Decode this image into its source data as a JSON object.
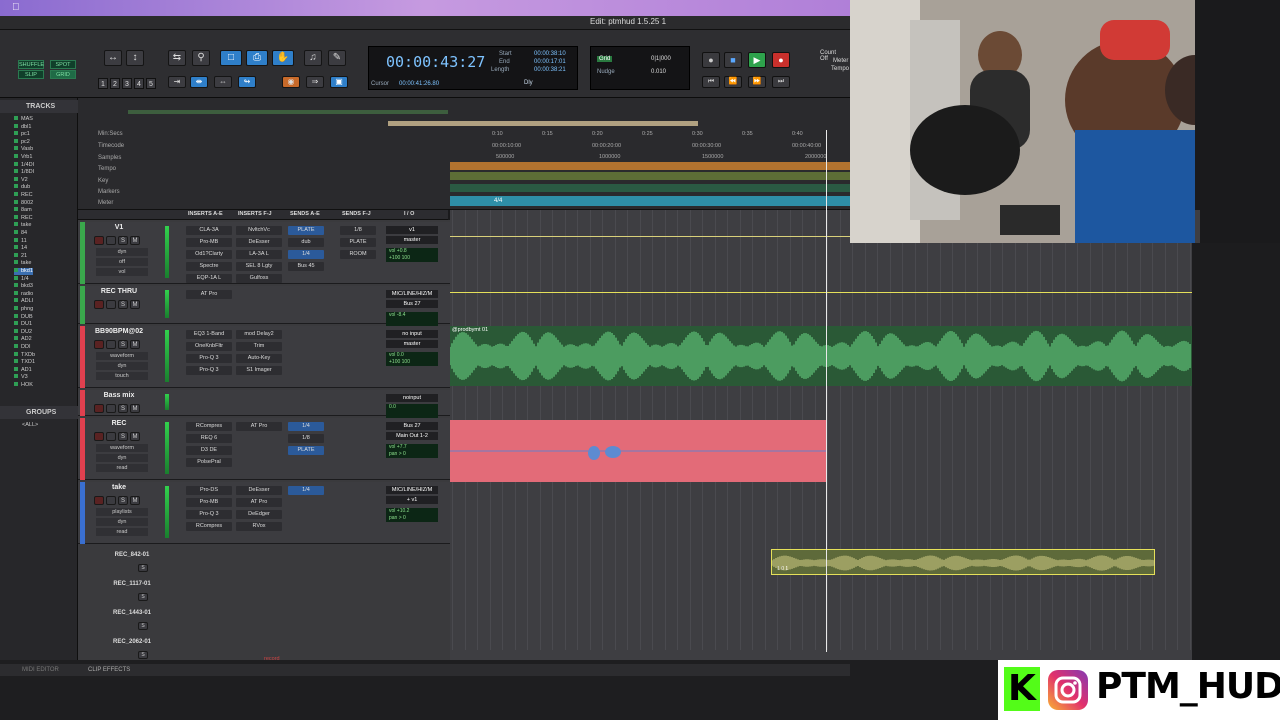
{
  "menubar": {
    "apple": ""
  },
  "window": {
    "title": "Edit: ptmhud 1.5.25 1"
  },
  "toolbar": {
    "modes": [
      "SHUFFLE",
      "SPOT",
      "SLIP",
      "GRID"
    ],
    "numbers": [
      "1",
      "2",
      "3",
      "4",
      "5"
    ],
    "counter": {
      "main": "00:00:43:27",
      "start_label": "Start",
      "end_label": "End",
      "length_label": "Length",
      "start": "00:00:38:10",
      "end": "00:00:17:01",
      "length": "00:00:38:21",
      "cursor_label": "Cursor",
      "cursor": "00:00:41:26.80",
      "dly": "Dly"
    },
    "edit": {
      "grid_label": "Grid",
      "grid_value": "0|1|000",
      "nudge_label": "Nudge",
      "nudge_value": "0.010"
    },
    "countoff": "Count Off",
    "meter": "Meter",
    "tempo": "Tempo"
  },
  "sidebar": {
    "tracks_header": "TRACKS",
    "groups_header": "GROUPS",
    "groups_item": "<ALL>",
    "tracks": [
      "MAS",
      "dbl1",
      "pc1",
      "pc2",
      "Vasb",
      "Vrb1",
      "1/4DI",
      "1/8DI",
      "V2",
      "dub",
      "REC",
      "8002",
      "8am",
      "REC",
      "take",
      "84",
      "11",
      "14",
      "21",
      "take",
      "bkd1",
      "1/4",
      "bkd3",
      "radio",
      "ADLI",
      "phng",
      "DUB",
      "DU1",
      "DU2",
      "AD2",
      "DDI",
      "TXDb",
      "TXD1",
      "AD1",
      "V3",
      "HOK"
    ]
  },
  "rulers": {
    "labels": [
      "Min:Secs",
      "Timecode",
      "Samples",
      "Tempo",
      "Key",
      "Markers",
      "Meter"
    ],
    "ticks_min": [
      "0:10",
      "0:15",
      "0:20",
      "0:25",
      "0:30",
      "0:35",
      "0:40"
    ],
    "ticks_tc": [
      "00:00:10:00",
      "00:00:20:00",
      "00:00:30:00",
      "00:00:40:00"
    ],
    "ticks_samp": [
      "500000",
      "1000000",
      "1500000",
      "2000000"
    ],
    "meter_value": "4/4"
  },
  "columns": [
    "INSERTS A-E",
    "INSERTS F-J",
    "SENDS A-E",
    "SENDS F-J",
    "I / O"
  ],
  "tracks": [
    {
      "name": "V1",
      "color": "#3aa84c",
      "inserts": [
        "CLA-3A",
        "Pro-MB",
        "Od1?Clarty",
        "Spectre",
        "EQP-1A L"
      ],
      "inserts2": [
        "NvltchVc",
        "DeEsser",
        "LA-3A L",
        "SEL 8 Lgty",
        "Gulfoss"
      ],
      "sends": [
        "PLATE",
        "dub",
        "1/4",
        "Bus 45"
      ],
      "sends2": [
        "1/8",
        "PLATE",
        "ROOM"
      ],
      "io": [
        "v1",
        "master"
      ],
      "vol": "vol +0.8",
      "pan": "+100  100",
      "labels": [
        "dyn",
        "off",
        "vol"
      ]
    },
    {
      "name": "REC THRU",
      "color": "#3aa84c",
      "inserts": [
        "AT Pro"
      ],
      "io": [
        "MIC/LINE/HIZ/M",
        "Bus 27"
      ],
      "vol": "vol -8.4"
    },
    {
      "name": "BB90BPM@02",
      "color": "#e0404f",
      "inserts": [
        "EQ3 1-Band",
        "OneKnbFltr",
        "Pro-Q 3",
        "Pro-Q 3"
      ],
      "inserts2": [
        "mod Delay2",
        "Trim",
        "Auto-Key",
        "S1 Imager"
      ],
      "io": [
        "no input",
        "master"
      ],
      "vol": "vol 0.0",
      "pan": "+100  100",
      "labels": [
        "waveform",
        "dyn",
        "touch"
      ]
    },
    {
      "name": "Bass mix",
      "color": "#e0404f",
      "io": [
        "noinput",
        "mastr"
      ],
      "vol": "0.0"
    },
    {
      "name": "REC",
      "color": "#e0404f",
      "inserts": [
        "RCompres",
        "REQ 6",
        "D3 DE",
        "PolsePral"
      ],
      "inserts2": [
        "AT Pro"
      ],
      "sends": [
        "1/4",
        "1/8",
        "PLATE"
      ],
      "io": [
        "Bus 27",
        "Main Out 1-2"
      ],
      "vol": "vol +7.7",
      "pan": "pan > 0",
      "labels": [
        "waveform",
        "dyn",
        "read"
      ]
    },
    {
      "name": "take",
      "color": "#3a6fd0",
      "inserts": [
        "Pro-DS",
        "Pro-MB",
        "Pro-Q 3",
        "RCompres"
      ],
      "inserts2": [
        "DeEsser",
        "AT Pro",
        "DeEdger",
        "RVox"
      ],
      "sends": [
        "1/4"
      ],
      "io": [
        "MIC/LINE/HIZ/M",
        "+ v1"
      ],
      "vol": "vol +10.2",
      "pan": "pan > 0",
      "labels": [
        "playlists",
        "dyn",
        "read"
      ]
    }
  ],
  "playlists": [
    "REC_842-01",
    "REC_1117-01",
    "REC_1443-01",
    "REC_2062-01"
  ],
  "clips": {
    "main": "@prodbymt 01",
    "take": "1 0 1"
  },
  "bottom_tabs": [
    "MIDI EDITOR",
    "CLIP EFFECTS"
  ],
  "status_center": "record",
  "branding": {
    "handle": "PTM_HUD",
    "kick": "K"
  },
  "colors": {
    "accent": "#2f7fc9",
    "green": "#53fc18"
  }
}
